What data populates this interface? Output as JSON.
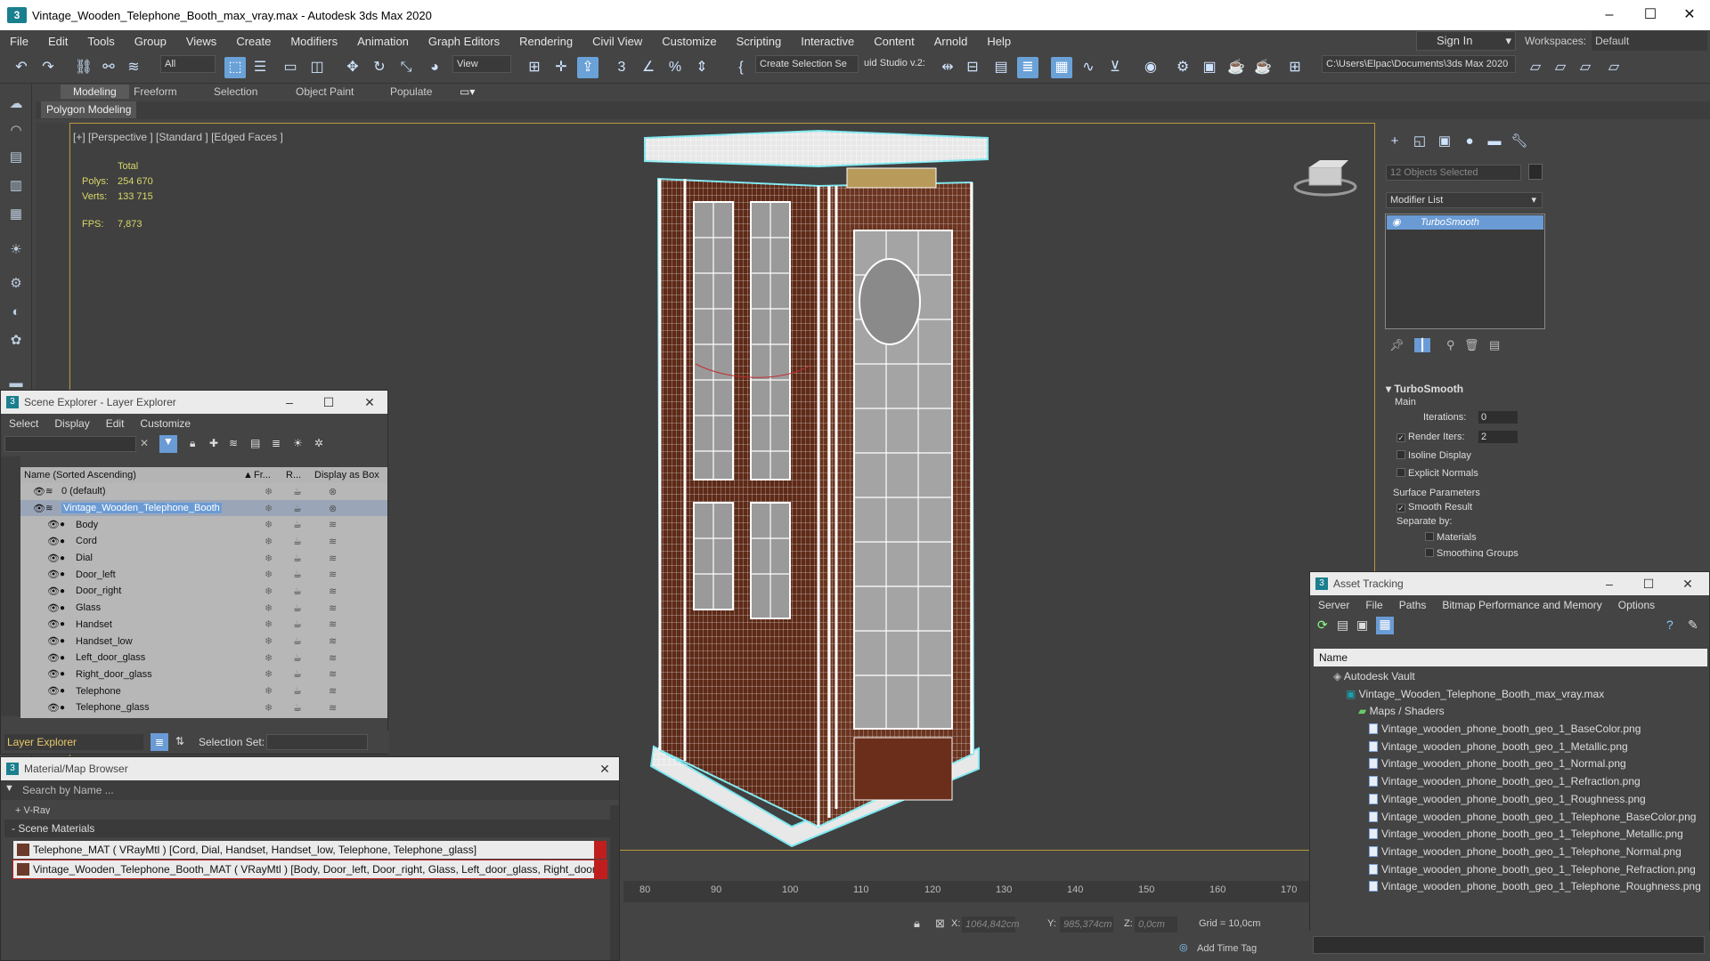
{
  "window": {
    "title": "Vintage_Wooden_Telephone_Booth_max_vray.max - Autodesk 3ds Max 2020",
    "logo": "3"
  },
  "menu": [
    "File",
    "Edit",
    "Tools",
    "Group",
    "Views",
    "Create",
    "Modifiers",
    "Animation",
    "Graph Editors",
    "Rendering",
    "Civil View",
    "Customize",
    "Scripting",
    "Interactive",
    "Content",
    "Arnold",
    "Help"
  ],
  "signin": "Sign In",
  "workspaces": {
    "label": "Workspaces:",
    "value": "Default"
  },
  "toolbar": {
    "filter": "All",
    "view": "View",
    "selection_set": "Create Selection Se",
    "studio": "uid Studio v.2:",
    "path": "C:\\Users\\Elpac\\Documents\\3ds Max 2020"
  },
  "ribbon": {
    "tabs": [
      "Modeling",
      "Freeform",
      "Selection",
      "Object Paint",
      "Populate"
    ],
    "active": "Modeling",
    "sub": "Polygon Modeling"
  },
  "viewport": {
    "label": "[+] [Perspective ] [Standard ] [Edged Faces ]",
    "stats": {
      "header": "Total",
      "polys_label": "Polys:",
      "polys": "254 670",
      "verts_label": "Verts:",
      "verts": "133 715",
      "fps_label": "FPS:",
      "fps": "7,873"
    }
  },
  "timeline": {
    "ticks": [
      "80",
      "90",
      "100",
      "110",
      "120",
      "130",
      "140",
      "150",
      "160",
      "170"
    ]
  },
  "status": {
    "x_label": "X:",
    "x": "1064,842cm",
    "y_label": "Y:",
    "y": "985,374cm",
    "z_label": "Z:",
    "z": "0,0cm",
    "grid": "Grid = 10,0cm",
    "add_time_tag": "Add Time Tag"
  },
  "command_panel": {
    "selected": "12 Objects Selected",
    "modifier_list": "Modifier List",
    "modifier": "TurboSmooth",
    "rollout": {
      "title": "TurboSmooth",
      "main": "Main",
      "iterations_label": "Iterations:",
      "iterations": "0",
      "render_iters_label": "Render Iters:",
      "render_iters": "2",
      "isoline": "Isoline Display",
      "explicit": "Explicit Normals",
      "surface": "Surface Parameters",
      "smooth": "Smooth Result",
      "separate": "Separate by:",
      "materials": "Materials",
      "smoothing": "Smoothing Groups"
    }
  },
  "scene_explorer": {
    "title": "Scene Explorer - Layer Explorer",
    "menu": [
      "Select",
      "Display",
      "Edit",
      "Customize"
    ],
    "columns": {
      "name": "Name (Sorted Ascending)",
      "fr": "Fr...",
      "r": "R...",
      "box": "Display as Box"
    },
    "layers": [
      {
        "name": "0 (default)",
        "level": 0
      },
      {
        "name": "Vintage_Wooden_Telephone_Booth",
        "level": 0
      }
    ],
    "objects": [
      "Body",
      "Cord",
      "Dial",
      "Door_left",
      "Door_right",
      "Glass",
      "Handset",
      "Handset_low",
      "Left_door_glass",
      "Right_door_glass",
      "Telephone",
      "Telephone_glass"
    ],
    "footer_layer": "Layer Explorer",
    "selection_set_label": "Selection Set:"
  },
  "material_browser": {
    "title": "Material/Map Browser",
    "search": "Search by Name ...",
    "vray": "+ V-Ray",
    "scene_materials": "- Scene Materials",
    "materials": [
      "Telephone_MAT ( VRayMtl ) [Cord, Dial, Handset, Handset_low, Telephone, Telephone_glass]",
      "Vintage_Wooden_Telephone_Booth_MAT ( VRayMtl ) [Body, Door_left, Door_right, Glass, Left_door_glass, Right_door_glass]"
    ]
  },
  "asset_tracking": {
    "title": "Asset Tracking",
    "menu": [
      "Server",
      "File",
      "Paths",
      "Bitmap Performance and Memory",
      "Options"
    ],
    "column": "Name",
    "vault": "Autodesk Vault",
    "file": "Vintage_Wooden_Telephone_Booth_max_vray.max",
    "maps": "Maps / Shaders",
    "textures": [
      "Vintage_wooden_phone_booth_geo_1_BaseColor.png",
      "Vintage_wooden_phone_booth_geo_1_Metallic.png",
      "Vintage_wooden_phone_booth_geo_1_Normal.png",
      "Vintage_wooden_phone_booth_geo_1_Refraction.png",
      "Vintage_wooden_phone_booth_geo_1_Roughness.png",
      "Vintage_wooden_phone_booth_geo_1_Telephone_BaseColor.png",
      "Vintage_wooden_phone_booth_geo_1_Telephone_Metallic.png",
      "Vintage_wooden_phone_booth_geo_1_Telephone_Normal.png",
      "Vintage_wooden_phone_booth_geo_1_Telephone_Refraction.png",
      "Vintage_wooden_phone_booth_geo_1_Telephone_Roughness.png"
    ]
  },
  "colors": {
    "accent": "#6a9bd4",
    "viewport_border": "#b89a3a",
    "stats": "#d8d86a",
    "wood": "#6b2e1a",
    "selection_outline": "#7fe8f0"
  }
}
